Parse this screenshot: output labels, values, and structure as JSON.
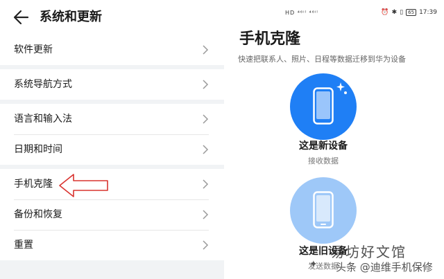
{
  "left_panel": {
    "title": "系统和更新",
    "groups": [
      {
        "items": [
          {
            "label": "软件更新"
          }
        ]
      },
      {
        "items": [
          {
            "label": "系统导航方式"
          }
        ]
      },
      {
        "items": [
          {
            "label": "语言和输入法"
          },
          {
            "label": "日期和时间"
          }
        ]
      },
      {
        "items": [
          {
            "label": "手机克隆"
          },
          {
            "label": "备份和恢复"
          },
          {
            "label": "重置"
          }
        ]
      }
    ],
    "highlight_arrow_color": "#d9332f"
  },
  "right_panel": {
    "status_bar": {
      "left_text": "HD ⁴⁶ᴵˡ ⁴⁶ᴵˡ",
      "time": "17:39",
      "battery": "65"
    },
    "title": "手机克隆",
    "subtitle": "快速把联系人、照片、日程等数据迁移到华为设备",
    "options": [
      {
        "title": "这是新设备",
        "subtitle": "接收数据",
        "color": "#1f7ff5"
      },
      {
        "title": "这是旧设备",
        "subtitle": "发送数据",
        "color": "#9ec8f8"
      }
    ],
    "watermark": {
      "brand": "易坊好文馆",
      "owner": "头条 @迪维手机保修"
    }
  }
}
